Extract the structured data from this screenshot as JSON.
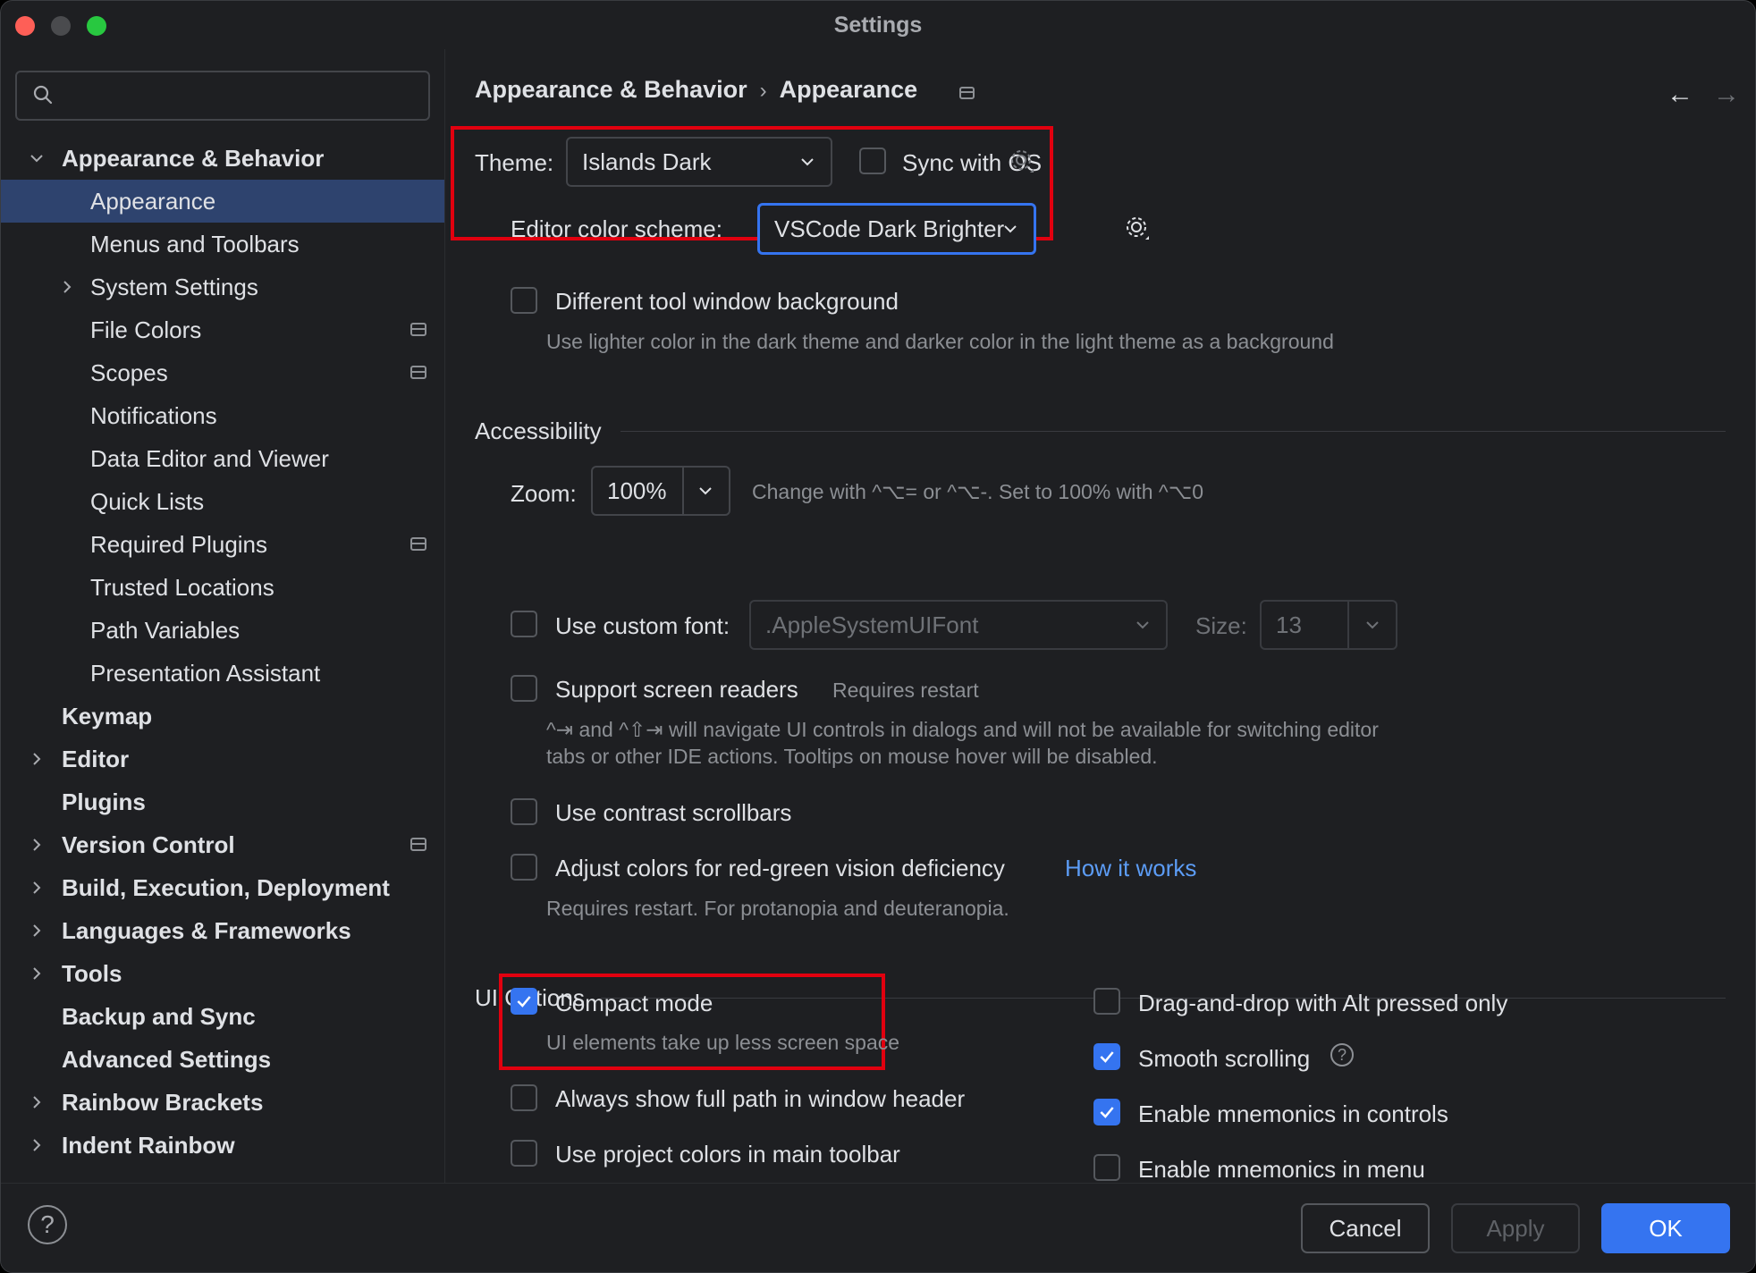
{
  "window": {
    "title": "Settings"
  },
  "search": {
    "value": "",
    "placeholder": ""
  },
  "sidebar": {
    "items": [
      {
        "label": "Appearance & Behavior",
        "level": 0,
        "expander": "expanded"
      },
      {
        "label": "Appearance",
        "level": 1,
        "selected": true
      },
      {
        "label": "Menus and Toolbars",
        "level": 1
      },
      {
        "label": "System Settings",
        "level": 1,
        "expander": "collapsed"
      },
      {
        "label": "File Colors",
        "level": 1,
        "pinned": true
      },
      {
        "label": "Scopes",
        "level": 1,
        "pinned": true
      },
      {
        "label": "Notifications",
        "level": 1
      },
      {
        "label": "Data Editor and Viewer",
        "level": 1
      },
      {
        "label": "Quick Lists",
        "level": 1
      },
      {
        "label": "Required Plugins",
        "level": 1,
        "pinned": true
      },
      {
        "label": "Trusted Locations",
        "level": 1
      },
      {
        "label": "Path Variables",
        "level": 1
      },
      {
        "label": "Presentation Assistant",
        "level": 1
      },
      {
        "label": "Keymap",
        "level": 0
      },
      {
        "label": "Editor",
        "level": 0,
        "expander": "collapsed"
      },
      {
        "label": "Plugins",
        "level": 0
      },
      {
        "label": "Version Control",
        "level": 0,
        "expander": "collapsed",
        "pinned": true
      },
      {
        "label": "Build, Execution, Deployment",
        "level": 0,
        "expander": "collapsed"
      },
      {
        "label": "Languages & Frameworks",
        "level": 0,
        "expander": "collapsed"
      },
      {
        "label": "Tools",
        "level": 0,
        "expander": "collapsed"
      },
      {
        "label": "Backup and Sync",
        "level": 0
      },
      {
        "label": "Advanced Settings",
        "level": 0
      },
      {
        "label": "Rainbow Brackets",
        "level": 0,
        "expander": "collapsed"
      },
      {
        "label": "Indent Rainbow",
        "level": 0,
        "expander": "collapsed"
      }
    ]
  },
  "breadcrumb": {
    "parent": "Appearance & Behavior",
    "separator": "›",
    "current": "Appearance"
  },
  "nav": {
    "back": "←",
    "forward": "→"
  },
  "theme": {
    "label": "Theme:",
    "value": "Islands Dark",
    "sync_label": "Sync with OS",
    "sync_checked": false
  },
  "editor_scheme": {
    "label": "Editor color scheme:",
    "value": "VSCode Dark Brighter"
  },
  "tool_window_bg": {
    "label": "Different tool window background",
    "hint": "Use lighter color in the dark theme and darker color in the light theme as a background",
    "checked": false
  },
  "accessibility": {
    "section": "Accessibility",
    "zoom_label": "Zoom:",
    "zoom_value": "100%",
    "zoom_hint": "Change with ^⌥= or ^⌥-. Set to 100% with ^⌥0",
    "custom_font_label": "Use custom font:",
    "custom_font_value": ".AppleSystemUIFont",
    "size_label": "Size:",
    "size_value": "13",
    "screen_readers_label": "Support screen readers",
    "screen_readers_note": "Requires restart",
    "screen_readers_hint_1": "^⇥ and ^⇧⇥ will navigate UI controls in dialogs and will not be available for switching editor",
    "screen_readers_hint_2": "tabs or other IDE actions. Tooltips on mouse hover will be disabled.",
    "contrast_scrollbars_label": "Use contrast scrollbars",
    "color_deficiency_label": "Adjust colors for red-green vision deficiency",
    "color_deficiency_link": "How it works",
    "color_deficiency_hint": "Requires restart. For protanopia and deuteranopia."
  },
  "ui_options": {
    "section": "UI Options",
    "compact_mode_label": "Compact mode",
    "compact_mode_hint": "UI elements take up less screen space",
    "compact_mode_checked": true,
    "full_path_label": "Always show full path in window header",
    "full_path_checked": false,
    "project_colors_label": "Use project colors in main toolbar",
    "project_colors_checked": false,
    "dnd_alt_label": "Drag-and-drop with Alt pressed only",
    "dnd_alt_checked": false,
    "smooth_scrolling_label": "Smooth scrolling",
    "smooth_scrolling_checked": true,
    "mnemonics_controls_label": "Enable mnemonics in controls",
    "mnemonics_controls_checked": true,
    "mnemonics_menu_label": "Enable mnemonics in menu",
    "mnemonics_menu_checked": false
  },
  "footer": {
    "help": "?",
    "cancel": "Cancel",
    "apply": "Apply",
    "ok": "OK"
  },
  "colors": {
    "background": "#1e1f22",
    "selection": "#2e436e",
    "accent": "#3574f0",
    "link": "#5c9cf5",
    "highlight_box": "#e1000f",
    "text": "#dfe1e5",
    "hint": "#8c8f94"
  }
}
